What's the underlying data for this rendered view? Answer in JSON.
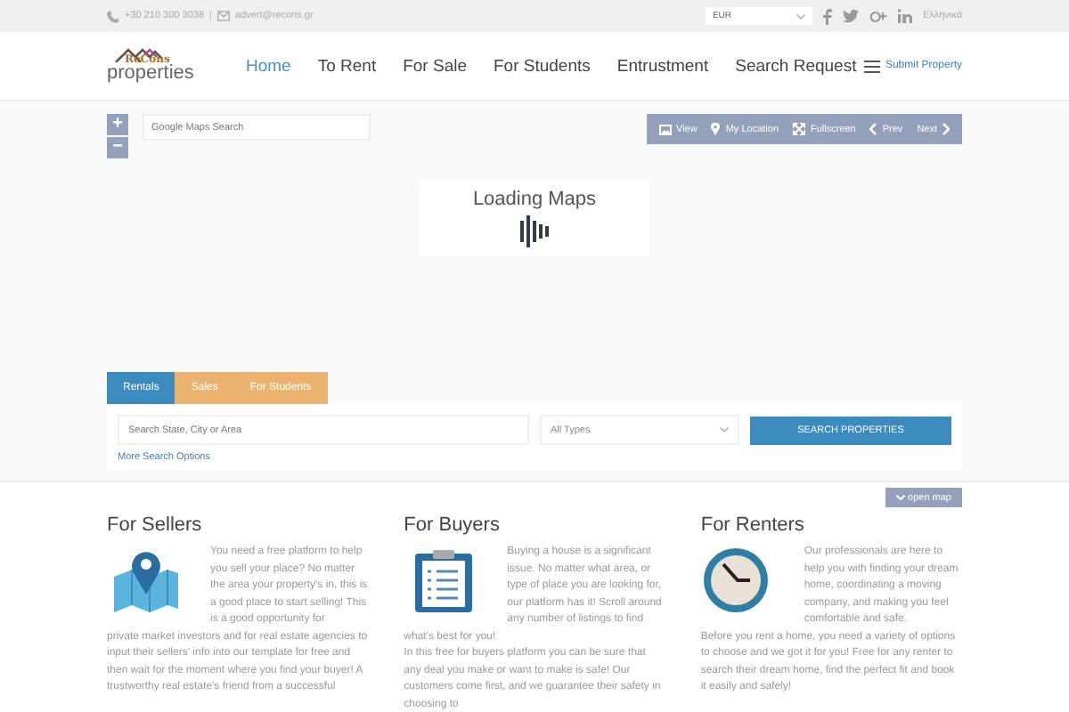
{
  "top_bar": {
    "phone": "+30 210 300 3038",
    "separator": "|",
    "email": "advert@recons.gr",
    "currency": "EUR",
    "language": "Ελληνικά"
  },
  "logo": {
    "brand": "ReCons",
    "tagline": "properties"
  },
  "nav": [
    {
      "label": "Home",
      "selected": true
    },
    {
      "label": "To Rent",
      "selected": false
    },
    {
      "label": "For Sale",
      "selected": false
    },
    {
      "label": "For Students",
      "selected": false
    },
    {
      "label": "Entrustment",
      "selected": false
    },
    {
      "label": "Search Request",
      "selected": false
    }
  ],
  "submit_property": "Submit Property",
  "map": {
    "zoom_in": "+",
    "zoom_out": "−",
    "search_placeholder": "Google Maps Search",
    "controls": [
      {
        "label": "View",
        "kind": "view"
      },
      {
        "label": "My Location",
        "kind": "location"
      },
      {
        "label": "Fullscreen",
        "kind": "fullscreen"
      },
      {
        "label": "Prev",
        "kind": "prev"
      },
      {
        "label": "Next",
        "kind": "next"
      }
    ],
    "loading": "Loading Maps"
  },
  "search_tabs": [
    {
      "label": "Rentals",
      "selected": true
    },
    {
      "label": "Sales",
      "selected": false
    },
    {
      "label": "For Students",
      "selected": false
    }
  ],
  "search": {
    "placeholder": "Search State, City or Area",
    "type": "All Types",
    "button": "SEARCH PROPERTIES",
    "more": "More Search Options"
  },
  "open_map": "open map",
  "columns": [
    {
      "title": "For Sellers",
      "kind": "map",
      "text": "You need a free platform to help you sell your place? No matter the area your property's in, this is a good place to start selling! This is a good opportunity for",
      "text2": "private market investors and for real estate agencies to input their sellers' info into our template for free and then wait for the moment where you find your buyer! A trustworthy real estate's friend from a successful"
    },
    {
      "title": "For Buyers",
      "kind": "clipboard",
      "text": "Buying a house is a significant issue. No matter what area, or type of place you are looking for, our platform has it! Scroll around any number of listings to find",
      "text2": "what's best for you!",
      "text3": "In this free for buyers platform you can be sure that any deal you make or want to make is safe! Our customers come first, and we guarantee their safety in choosing to"
    },
    {
      "title": "For Renters",
      "kind": "clock",
      "text": "Our professionals are here to help you with finding your dream home, coordinating a moving company, and making you feel comfortable and safe.",
      "text2": "Before you rent a home, you need a variety of options to choose and we got it for you! Free for any renter to search their dream home, find the perfect fit and book it easily and safely!"
    }
  ]
}
